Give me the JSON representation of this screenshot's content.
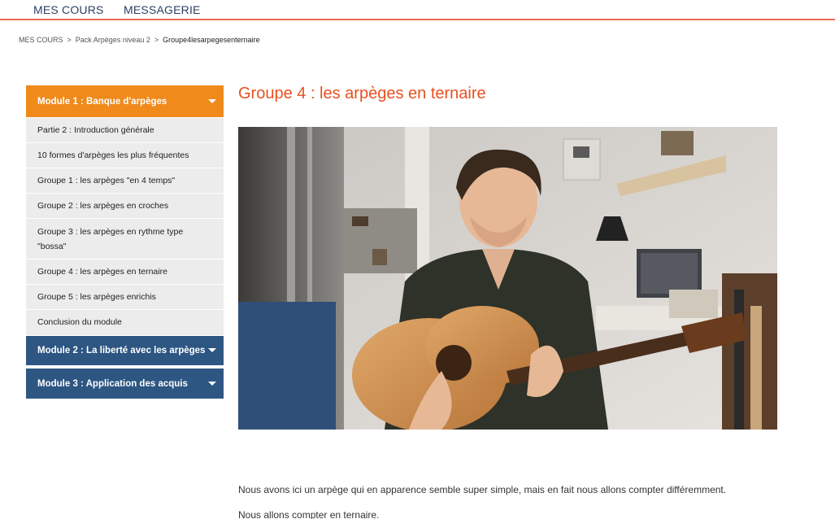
{
  "nav": {
    "courses": "MES COURS",
    "messages": "MESSAGERIE"
  },
  "breadcrumb": {
    "items": [
      "MES COURS",
      "Pack Arpèges niveau 2"
    ],
    "current": "Groupe4lesarpegesenternaire",
    "separator": ">"
  },
  "sidebar": {
    "module1": {
      "title": "Module 1 : Banque d'arpèges",
      "lessons": [
        "Partie 2 : Introduction générale",
        "10 formes d'arpèges les plus fréquentes",
        "Groupe 1 : les arpèges \"en 4 temps\"",
        "Groupe 2 : les arpèges en croches",
        "Groupe 3 : les arpèges en rythme type \"bossa\"",
        "Groupe 4 : les arpèges en ternaire",
        "Groupe 5 : les arpèges enrichis",
        "Conclusion du module"
      ]
    },
    "module2": {
      "title": "Module 2 : La liberté avec les arpèges"
    },
    "module3": {
      "title": "Module 3 : Application des acquis"
    }
  },
  "main": {
    "title": "Groupe 4 : les arpèges en ternaire",
    "paragraphs": [
      "Nous avons ici un arpège qui en apparence semble super simple, mais en fait nous allons compter différemment.",
      "Nous allons compter en ternaire."
    ]
  },
  "colors": {
    "accent_orange": "#ef8a1b",
    "title_red": "#e8501f",
    "module_blue": "#2d5683",
    "nav_underline": "#ec6b55"
  }
}
